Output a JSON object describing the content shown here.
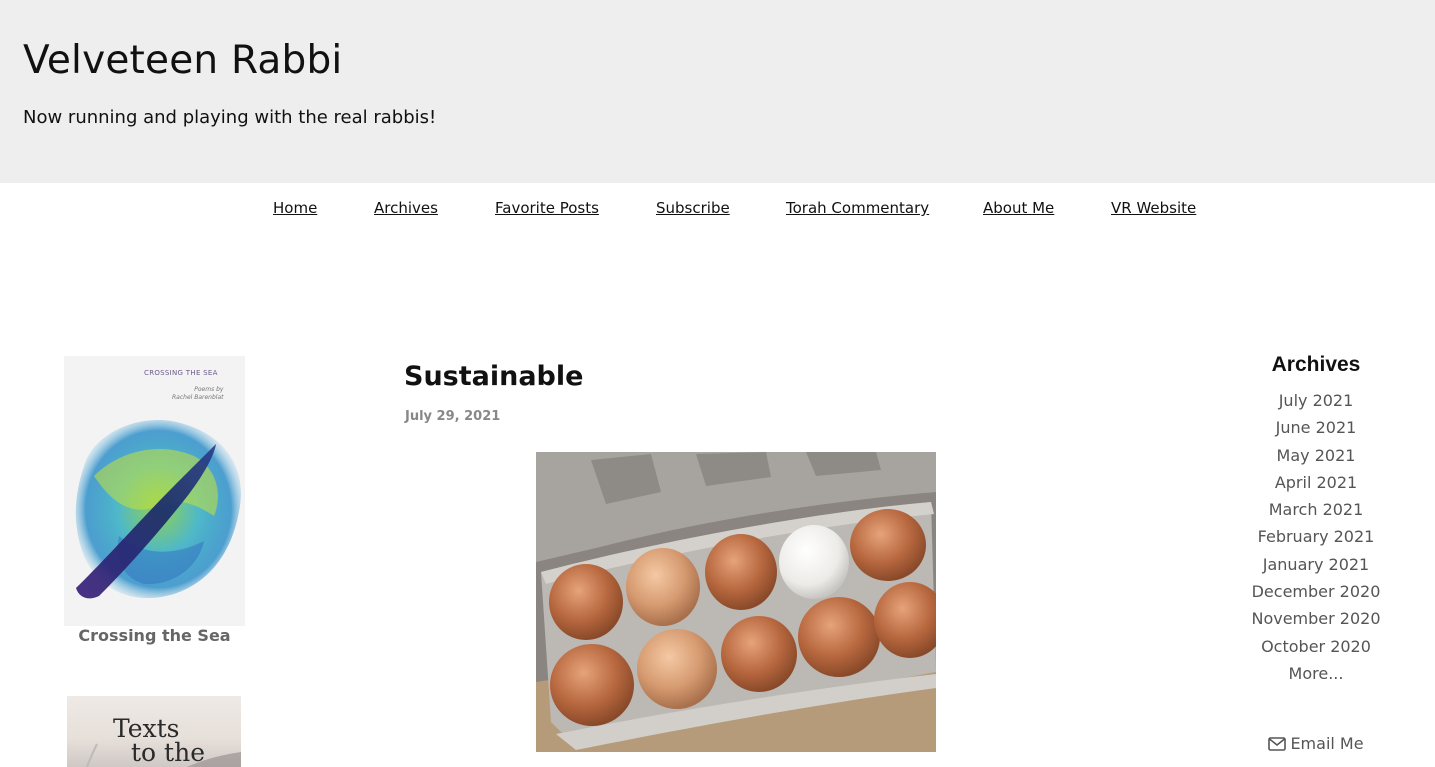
{
  "site": {
    "title": "Velveteen Rabbi",
    "tagline": "Now running and playing with the real rabbis!"
  },
  "nav": {
    "items": [
      {
        "label": "Home"
      },
      {
        "label": "Archives"
      },
      {
        "label": "Favorite Posts"
      },
      {
        "label": "Subscribe"
      },
      {
        "label": "Torah Commentary"
      },
      {
        "label": "About Me"
      },
      {
        "label": "VR Website"
      }
    ]
  },
  "left_sidebar": {
    "book1": {
      "cover_title": "CROSSING THE SEA",
      "cover_sub_line1": "Poems by",
      "cover_sub_line2": "Rachel Barenblat",
      "caption": "Crossing the Sea"
    },
    "book2": {
      "cover_title_line1": "Texts",
      "cover_title_line2": "to the"
    }
  },
  "post": {
    "title": "Sustainable",
    "date": "July 29, 2021",
    "image_icon": "egg-carton-photo"
  },
  "right_sidebar": {
    "heading": "Archives",
    "months": [
      "July 2021",
      "June 2021",
      "May 2021",
      "April 2021",
      "March 2021",
      "February 2021",
      "January 2021",
      "December 2020",
      "November 2020",
      "October 2020",
      "More..."
    ],
    "email_label": "Email Me",
    "email_icon": "envelope-icon"
  }
}
